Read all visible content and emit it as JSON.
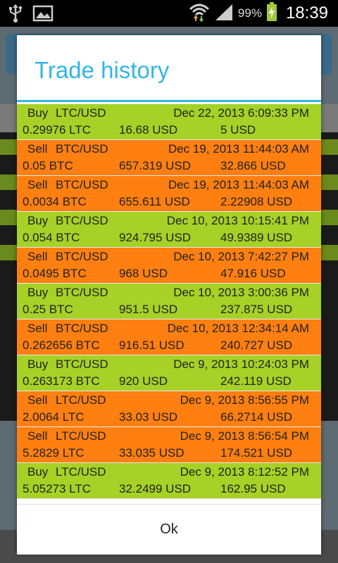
{
  "status_bar": {
    "battery": "99%",
    "time": "18:39",
    "icons": [
      "usb-icon",
      "image-icon",
      "wifi-icon",
      "signal-icon",
      "battery-charging-icon"
    ]
  },
  "dialog": {
    "title": "Trade history",
    "ok_label": "Ok"
  },
  "trades": [
    {
      "type": "Buy",
      "pair": "LTC/USD",
      "date": "Dec 22, 2013 6:09:33 PM",
      "amount": "0.29976 LTC",
      "price": "16.68 USD",
      "total": "5 USD"
    },
    {
      "type": "Sell",
      "pair": "BTC/USD",
      "date": "Dec 19, 2013 11:44:03 AM",
      "amount": "0.05 BTC",
      "price": "657.319 USD",
      "total": "32.866 USD"
    },
    {
      "type": "Sell",
      "pair": "BTC/USD",
      "date": "Dec 19, 2013 11:44:03 AM",
      "amount": "0.0034 BTC",
      "price": "655.611 USD",
      "total": "2.22908 USD"
    },
    {
      "type": "Buy",
      "pair": "BTC/USD",
      "date": "Dec 10, 2013 10:15:41 PM",
      "amount": "0.054 BTC",
      "price": "924.795 USD",
      "total": "49.9389 USD"
    },
    {
      "type": "Sell",
      "pair": "BTC/USD",
      "date": "Dec 10, 2013 7:42:27 PM",
      "amount": "0.0495 BTC",
      "price": "968 USD",
      "total": "47.916 USD"
    },
    {
      "type": "Buy",
      "pair": "BTC/USD",
      "date": "Dec 10, 2013 3:00:36 PM",
      "amount": "0.25 BTC",
      "price": "951.5 USD",
      "total": "237.875 USD"
    },
    {
      "type": "Sell",
      "pair": "BTC/USD",
      "date": "Dec 10, 2013 12:34:14 AM",
      "amount": "0.262656 BTC",
      "price": "916.51 USD",
      "total": "240.727 USD"
    },
    {
      "type": "Buy",
      "pair": "BTC/USD",
      "date": "Dec 9, 2013 10:24:03 PM",
      "amount": "0.263173 BTC",
      "price": "920 USD",
      "total": "242.119 USD"
    },
    {
      "type": "Sell",
      "pair": "LTC/USD",
      "date": "Dec 9, 2013 8:56:55 PM",
      "amount": "2.0064 LTC",
      "price": "33.03 USD",
      "total": "66.2714 USD"
    },
    {
      "type": "Sell",
      "pair": "LTC/USD",
      "date": "Dec 9, 2013 8:56:54 PM",
      "amount": "5.2829 LTC",
      "price": "33.035 USD",
      "total": "174.521 USD"
    },
    {
      "type": "Buy",
      "pair": "LTC/USD",
      "date": "Dec 9, 2013 8:12:52 PM",
      "amount": "5.05273 LTC",
      "price": "32.2499 USD",
      "total": "162.95 USD"
    }
  ]
}
